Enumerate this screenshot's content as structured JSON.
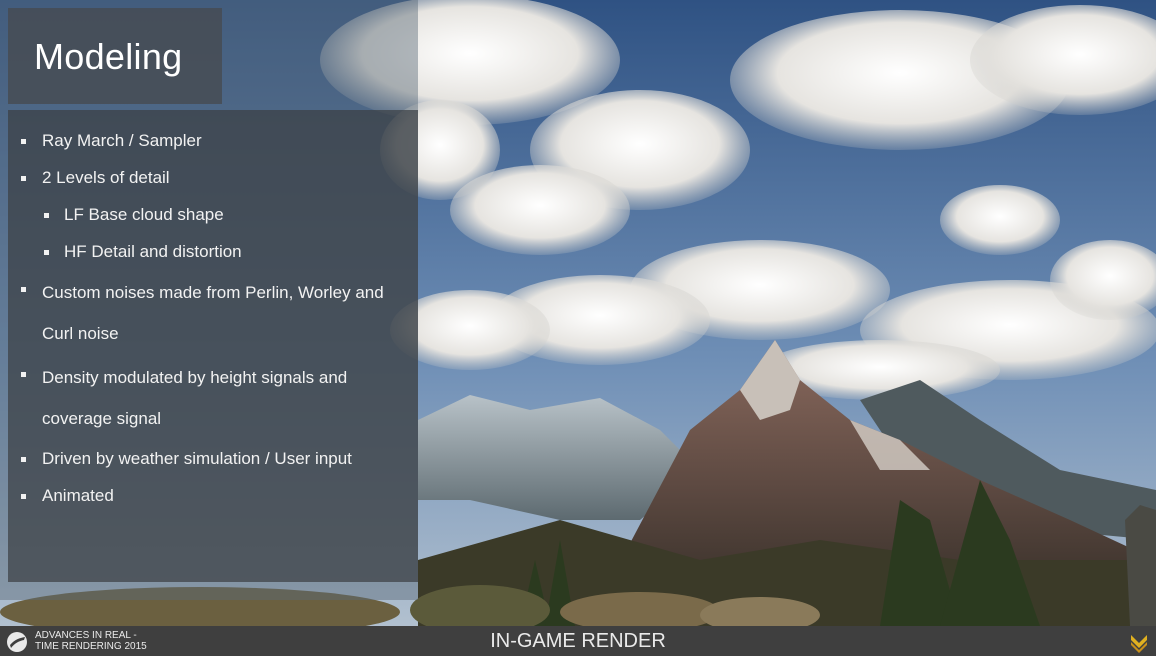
{
  "slide": {
    "title": "Modeling",
    "bullets": [
      {
        "text": "Ray March / Sampler",
        "level": 1
      },
      {
        "text": "2 Levels of detail",
        "level": 1
      },
      {
        "text": "LF Base cloud shape",
        "level": 2
      },
      {
        "text": "HF Detail and distortion",
        "level": 2
      },
      {
        "text": "Custom noises made from Perlin, Worley and Curl noise",
        "level": 1
      },
      {
        "text": "Density modulated by height signals and coverage signal",
        "level": 1
      },
      {
        "text": "Driven by weather simulation / User input",
        "level": 1
      },
      {
        "text": "Animated",
        "level": 1
      }
    ]
  },
  "footer": {
    "org_line1": "ADVANCES IN REAL -",
    "org_line2": "TIME RENDERING 2015",
    "caption": "IN-GAME RENDER"
  },
  "colors": {
    "sky_top": "#3a5a86",
    "sky_bottom": "#7d9bc0",
    "panel": "#3c4044",
    "footer": "#3f3f3f",
    "accent_logo": "#e0b020"
  },
  "icons": [
    "advances-logo-icon",
    "studio-chevron-logo-icon"
  ]
}
